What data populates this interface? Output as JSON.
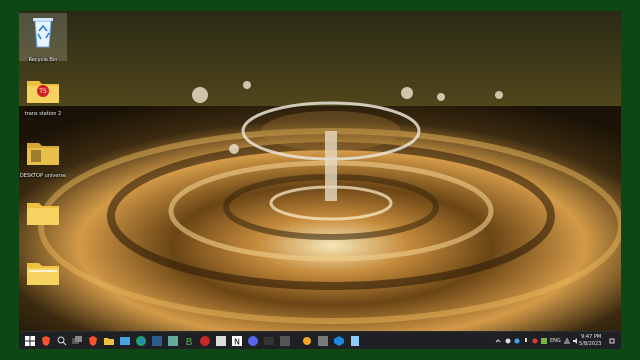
{
  "desktop": {
    "icons": [
      {
        "label": "Recycle Bin",
        "icon": "recycle-bin-icon"
      },
      {
        "label": "trans station 2",
        "icon": "folder-icon"
      },
      {
        "label": "DESKTOP universe",
        "icon": "folder-icon"
      },
      {
        "label": "",
        "icon": "folder-icon"
      },
      {
        "label": "",
        "icon": "folder-icon"
      }
    ]
  },
  "taskbar": {
    "apps": [
      "start-icon",
      "brave-browser-icon",
      "search-icon",
      "task-view-icon",
      "brave-icon",
      "folder-icon",
      "file-explorer-icon",
      "edge-icon",
      "app-icon",
      "app-icon",
      "app-icon",
      "app-icon",
      "app-icon",
      "notion-icon",
      "discord-icon",
      "terminal-icon",
      "app-icon",
      "app-icon",
      "app-icon",
      "app-icon",
      "app-icon"
    ],
    "tray": {
      "language": "ENG",
      "time": "9:47 PM",
      "date": "5/8/2023"
    }
  },
  "colors": {
    "frame": "#0e4713",
    "taskbar": "#1f2024",
    "folder": "#f0c040"
  }
}
